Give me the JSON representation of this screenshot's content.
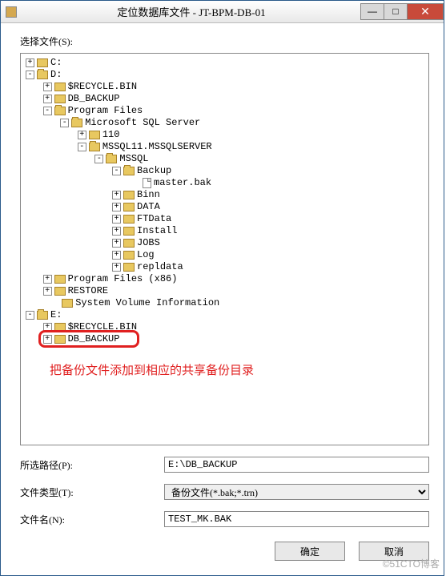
{
  "window": {
    "title": "定位数据库文件 - JT-BPM-DB-01",
    "minimize": "—",
    "maximize": "□",
    "close": "✕"
  },
  "labels": {
    "selectFile": "选择文件(S):",
    "selectedPath": "所选路径(P):",
    "fileType": "文件类型(T):",
    "fileName": "文件名(N):"
  },
  "tree": {
    "c": "C:",
    "d": "D:",
    "recycle": "$RECYCLE.BIN",
    "dbBackup": "DB_BACKUP",
    "programFiles": "Program Files",
    "msSql": "Microsoft SQL Server",
    "n110": "110",
    "mssql11": "MSSQL11.MSSQLSERVER",
    "mssql": "MSSQL",
    "backup": "Backup",
    "masterBak": "master.bak",
    "binn": "Binn",
    "data": "DATA",
    "ftdata": "FTData",
    "install": "Install",
    "jobs": "JOBS",
    "log": "Log",
    "repldata": "repldata",
    "programFilesX86": "Program Files (x86)",
    "restore": "RESTORE",
    "sysVol": "System Volume Information",
    "e": "E:",
    "eRecycle": "$RECYCLE.BIN",
    "eDbBackup": "DB_BACKUP"
  },
  "annotation": "把备份文件添加到相应的共享备份目录",
  "form": {
    "pathValue": "E:\\DB_BACKUP",
    "fileTypeValue": "备份文件(*.bak;*.trn)",
    "fileNameValue": "TEST_MK.BAK"
  },
  "buttons": {
    "ok": "确定",
    "cancel": "取消"
  },
  "watermark": "©51CTO博客"
}
